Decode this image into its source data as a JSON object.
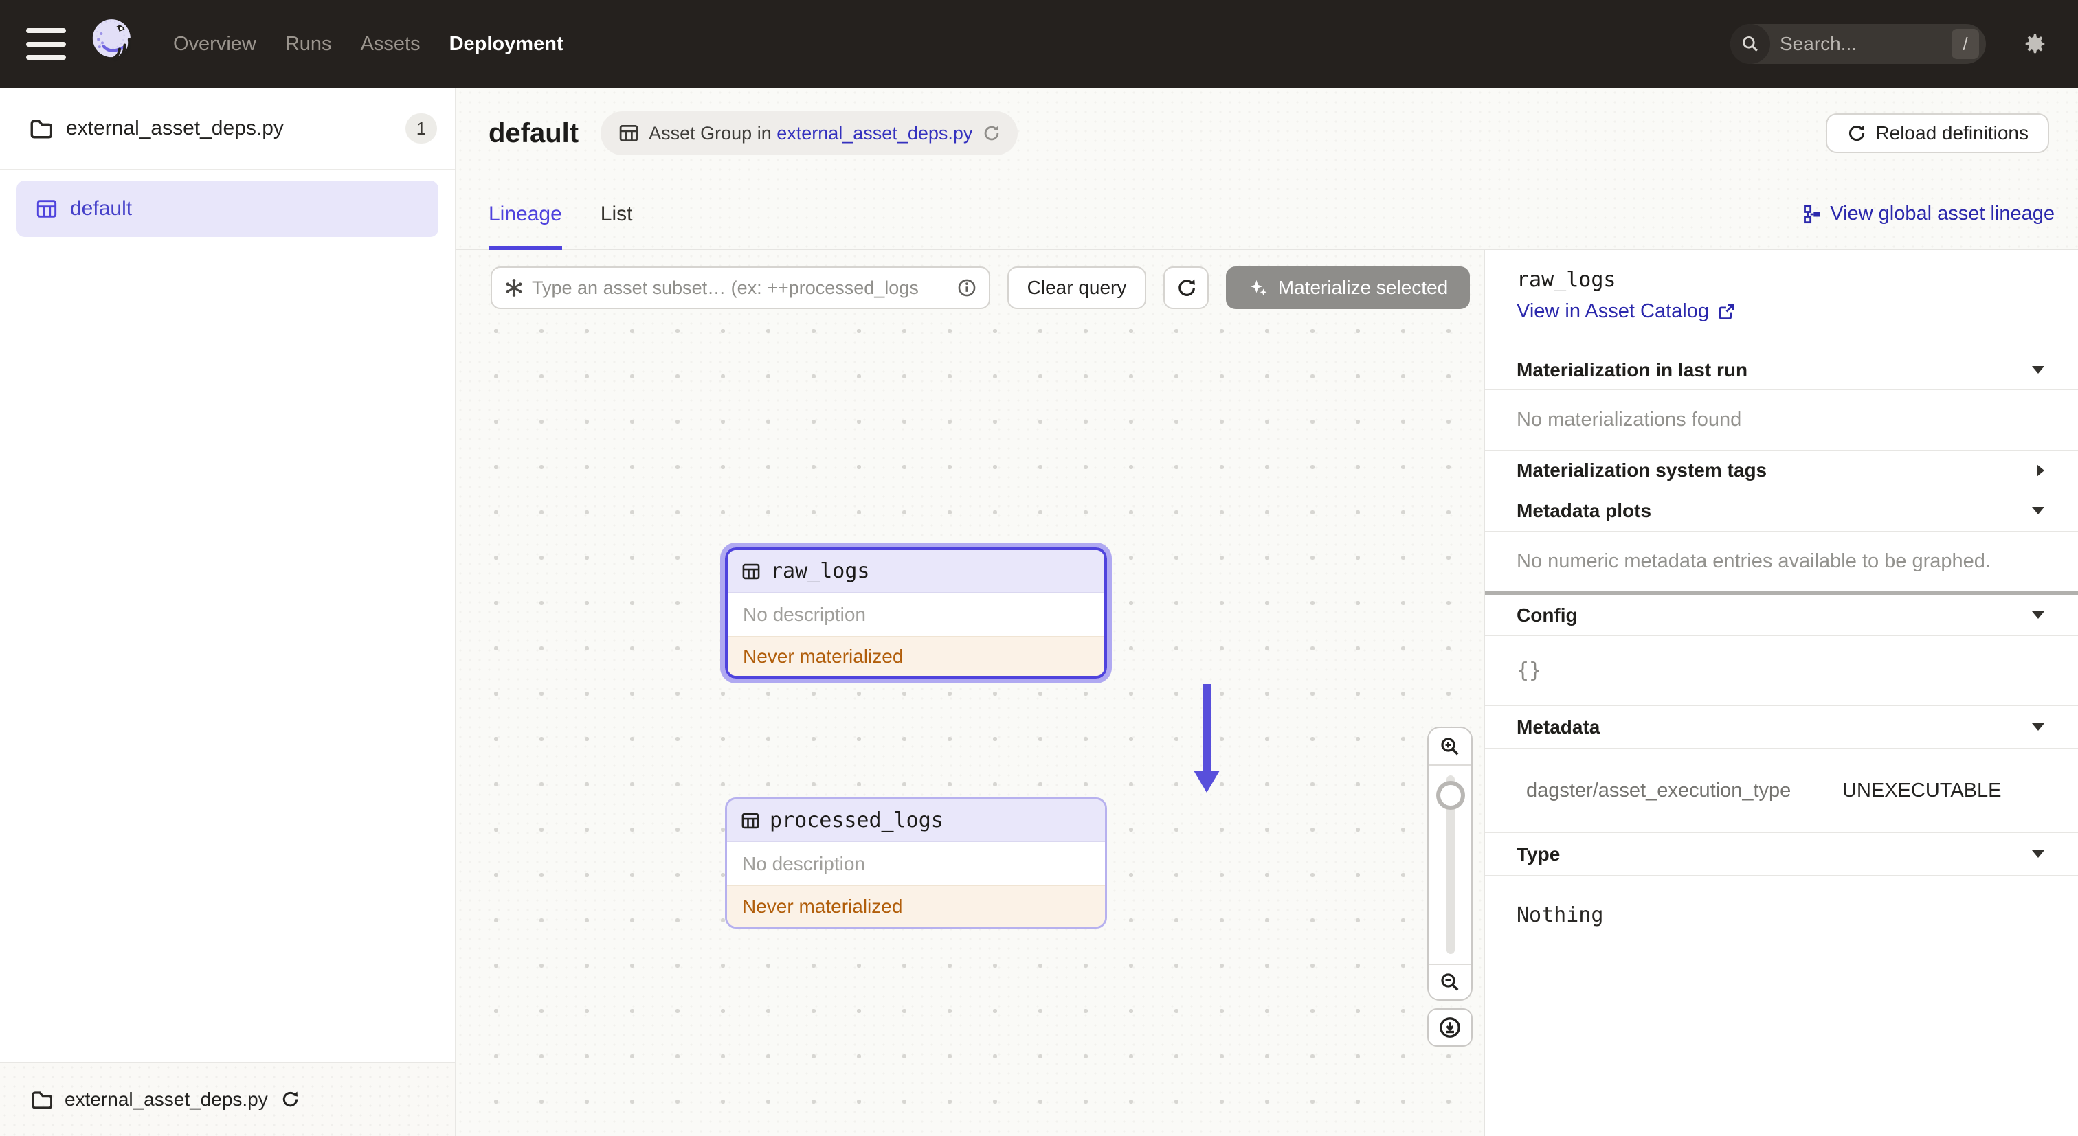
{
  "colors": {
    "accent": "#4F43DD",
    "link": "#2B28AC",
    "breadcrumb_link": "#3431BE",
    "warning_text": "#B15E0B",
    "warning_bg": "#FBF2E7",
    "nav_bg": "#25211E",
    "selected_item_bg": "#E8E6FA"
  },
  "nav": {
    "items": [
      {
        "label": "Overview"
      },
      {
        "label": "Runs"
      },
      {
        "label": "Assets"
      },
      {
        "label": "Deployment"
      }
    ],
    "search": {
      "placeholder": "Search...",
      "shortcut": "/"
    }
  },
  "sidebar": {
    "file": {
      "label": "external_asset_deps.py",
      "count": "1"
    },
    "group": {
      "label": "default"
    },
    "footer": {
      "label": "external_asset_deps.py"
    }
  },
  "header": {
    "title": "default",
    "breadcrumb": {
      "prefix": "Asset Group in ",
      "link": "external_asset_deps.py"
    },
    "reload_label": "Reload definitions"
  },
  "tabs": {
    "lineage": "Lineage",
    "list": "List",
    "global_lineage_link": "View global asset lineage"
  },
  "toolbar": {
    "query_placeholder": "Type an asset subset… (ex: ++processed_logs",
    "clear_label": "Clear query",
    "materialize_label": "Materialize selected"
  },
  "graph": {
    "nodes": [
      {
        "name": "raw_logs",
        "description": "No description",
        "status": "Never materialized"
      },
      {
        "name": "processed_logs",
        "description": "No description",
        "status": "Never materialized"
      }
    ]
  },
  "panel": {
    "title": "raw_logs",
    "catalog_link": "View in Asset Catalog",
    "sections": {
      "last_run": {
        "label": "Materialization in last run",
        "content": "No materializations found"
      },
      "system_tags": {
        "label": "Materialization system tags"
      },
      "metadata_plots": {
        "label": "Metadata plots",
        "content": "No numeric metadata entries available to be graphed."
      },
      "config": {
        "label": "Config",
        "content": "{}"
      },
      "metadata": {
        "label": "Metadata",
        "key": "dagster/asset_execution_type",
        "value": "UNEXECUTABLE"
      },
      "type": {
        "label": "Type",
        "content": "Nothing"
      }
    }
  }
}
